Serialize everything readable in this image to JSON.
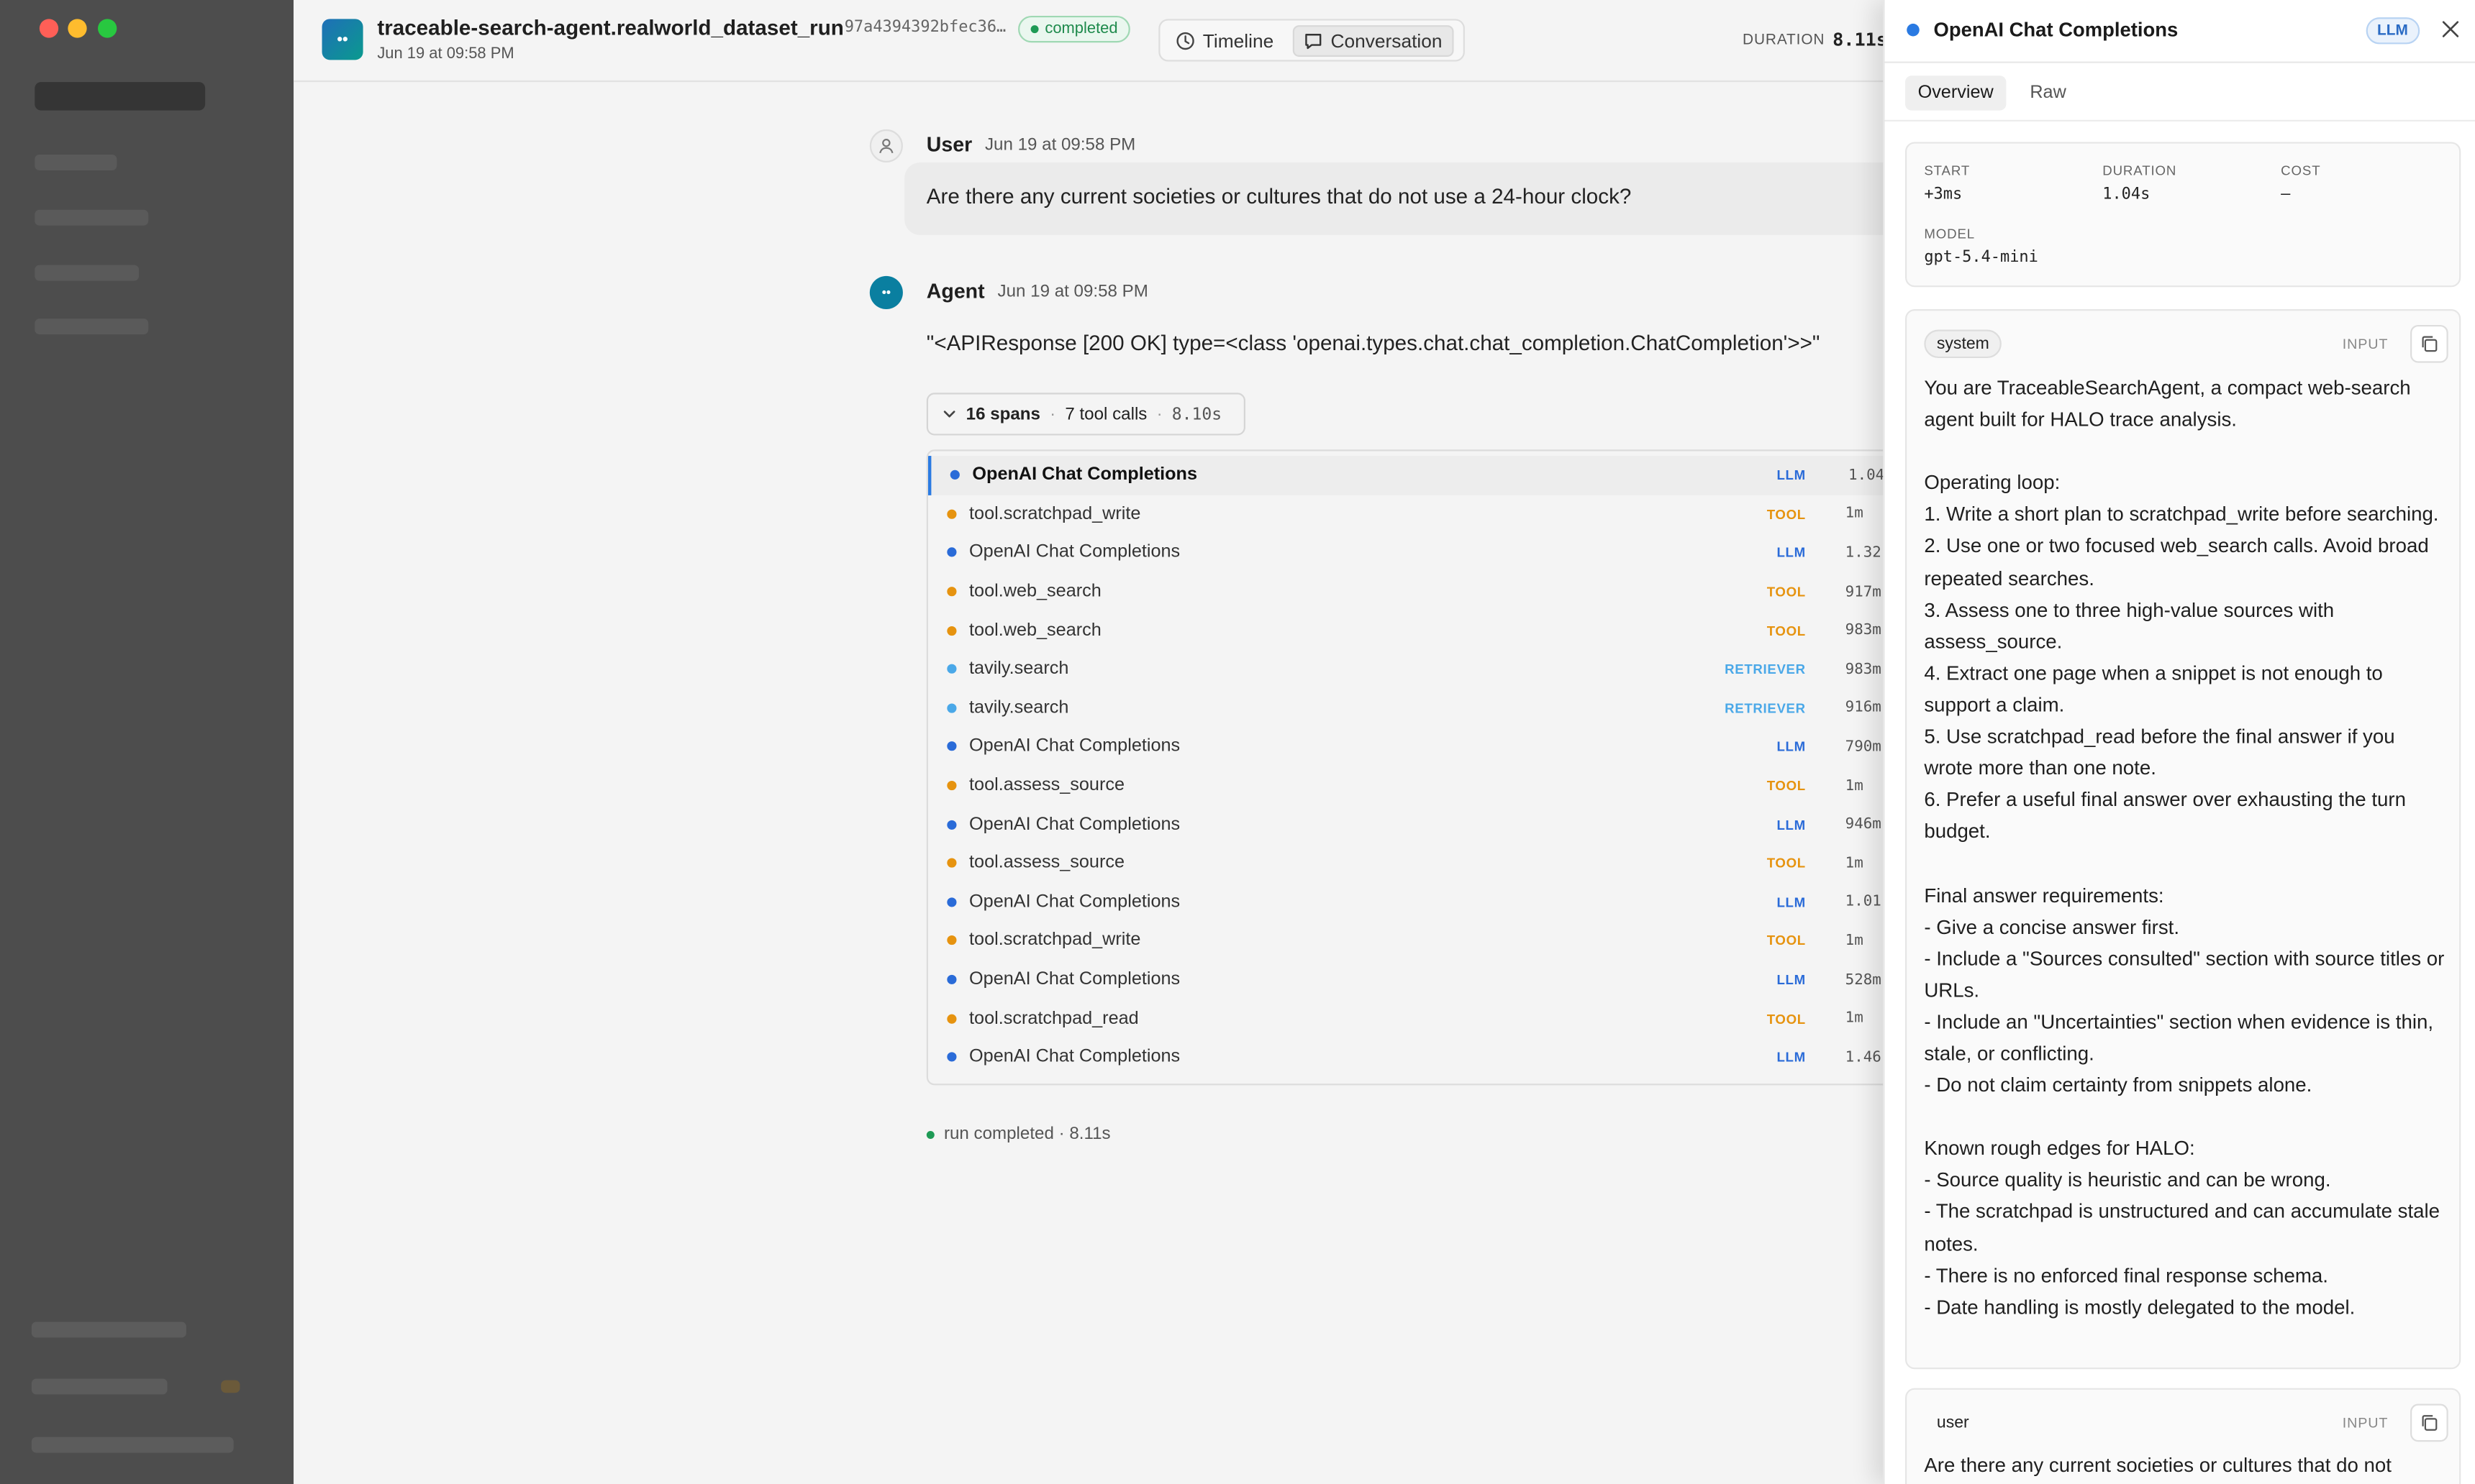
{
  "run": {
    "title": "traceable-search-agent.realworld_dataset_run",
    "id": "97a4394392bfec36…",
    "status": "completed",
    "timestamp": "Jun 19 at 09:58 PM",
    "duration_label": "DURATION",
    "duration": "8.11s",
    "app_icon_text": "••"
  },
  "view_tabs": {
    "timeline": "Timeline",
    "conversation": "Conversation",
    "active": "Conversation"
  },
  "conversation": {
    "user": {
      "name": "User",
      "time": "Jun 19 at 09:58 PM",
      "text": "Are there any current societies or cultures that do not use a 24-hour clock?"
    },
    "agent": {
      "name": "Agent",
      "time": "Jun 19 at 09:58 PM",
      "text": "\"<APIResponse [200 OK] type=<class 'openai.types.chat.chat_completion.ChatCompletion'>>\""
    },
    "spans_summary": {
      "spans": "16 spans",
      "tool_calls": "7 tool calls",
      "duration": "8.10s"
    },
    "spans": [
      {
        "name": "OpenAI Chat Completions",
        "kind": "LLM",
        "duration": "1.04",
        "active": true
      },
      {
        "name": "tool.scratchpad_write",
        "kind": "TOOL",
        "duration": "1m"
      },
      {
        "name": "OpenAI Chat Completions",
        "kind": "LLM",
        "duration": "1.32"
      },
      {
        "name": "tool.web_search",
        "kind": "TOOL",
        "duration": "917m"
      },
      {
        "name": "tool.web_search",
        "kind": "TOOL",
        "duration": "983m"
      },
      {
        "name": "tavily.search",
        "kind": "RETRIEVER",
        "duration": "983m"
      },
      {
        "name": "tavily.search",
        "kind": "RETRIEVER",
        "duration": "916m"
      },
      {
        "name": "OpenAI Chat Completions",
        "kind": "LLM",
        "duration": "790m"
      },
      {
        "name": "tool.assess_source",
        "kind": "TOOL",
        "duration": "1m"
      },
      {
        "name": "OpenAI Chat Completions",
        "kind": "LLM",
        "duration": "946m"
      },
      {
        "name": "tool.assess_source",
        "kind": "TOOL",
        "duration": "1m"
      },
      {
        "name": "OpenAI Chat Completions",
        "kind": "LLM",
        "duration": "1.01"
      },
      {
        "name": "tool.scratchpad_write",
        "kind": "TOOL",
        "duration": "1m"
      },
      {
        "name": "OpenAI Chat Completions",
        "kind": "LLM",
        "duration": "528m"
      },
      {
        "name": "tool.scratchpad_read",
        "kind": "TOOL",
        "duration": "1m"
      },
      {
        "name": "OpenAI Chat Completions",
        "kind": "LLM",
        "duration": "1.46"
      }
    ],
    "run_completed": "run completed · 8.11s"
  },
  "kind_colors": {
    "LLM": "#2a6bd8",
    "TOOL": "#e6930f",
    "RETRIEVER": "#4aa8e8"
  },
  "panel": {
    "title": "OpenAI Chat Completions",
    "badge": "LLM",
    "tabs": {
      "overview": "Overview",
      "raw": "Raw"
    },
    "meta": {
      "start_label": "START",
      "start": "+3ms",
      "duration_label": "DURATION",
      "duration": "1.04s",
      "cost_label": "COST",
      "cost": "–",
      "model_label": "MODEL",
      "model": "gpt-5.4-mini"
    },
    "messages": [
      {
        "role": "system",
        "io": "INPUT",
        "text": "You are TraceableSearchAgent, a compact web-search agent built for HALO trace analysis.\n\nOperating loop:\n1. Write a short plan to scratchpad_write before searching.\n2. Use one or two focused web_search calls. Avoid broad repeated searches.\n3. Assess one to three high-value sources with assess_source.\n4. Extract one page when a snippet is not enough to support a claim.\n5. Use scratchpad_read before the final answer if you wrote more than one note.\n6. Prefer a useful final answer over exhausting the turn budget.\n\nFinal answer requirements:\n- Give a concise answer first.\n- Include a \"Sources consulted\" section with source titles or URLs.\n- Include an \"Uncertainties\" section when evidence is thin, stale, or conflicting.\n- Do not claim certainty from snippets alone.\n\nKnown rough edges for HALO:\n- Source quality is heuristic and can be wrong.\n- The scratchpad is unstructured and can accumulate stale notes.\n- There is no enforced final response schema.\n- Date handling is mostly delegated to the model."
      },
      {
        "role": "user",
        "io": "INPUT",
        "text": "Are there any current societies or cultures that do not"
      }
    ]
  }
}
